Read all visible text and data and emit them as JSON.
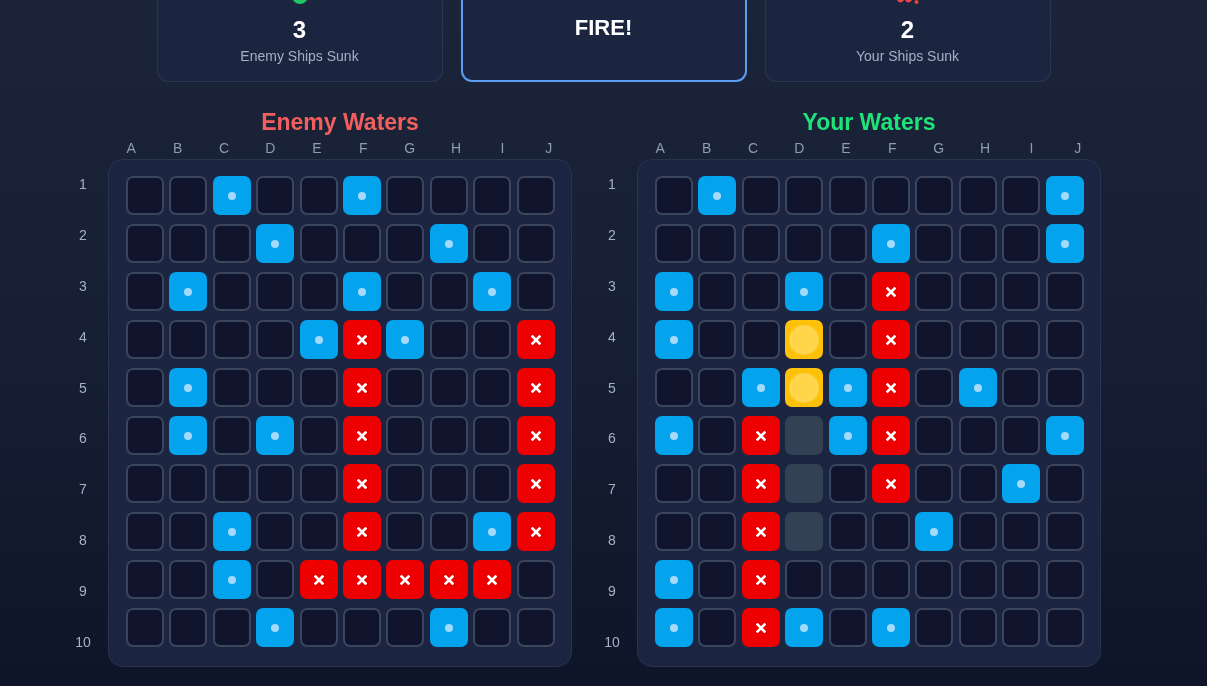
{
  "scoreboard": {
    "enemy_ships_sunk": {
      "value": "3",
      "label": "Enemy Ships Sunk"
    },
    "fire_button": {
      "label": "FIRE!"
    },
    "your_ships_sunk": {
      "value": "2",
      "label": "Your Ships Sunk"
    }
  },
  "boards": [
    {
      "title": "Enemy Waters",
      "color": "#f25f5c",
      "columns": [
        "A",
        "B",
        "C",
        "D",
        "E",
        "F",
        "G",
        "H",
        "I",
        "J"
      ],
      "rows": [
        {
          "label": "1",
          "cells": [
            {
              "kind": "empty"
            },
            {
              "kind": "empty"
            },
            {
              "kind": "miss"
            },
            {
              "kind": "empty"
            },
            {
              "kind": "empty"
            },
            {
              "kind": "miss"
            },
            {
              "kind": "empty"
            },
            {
              "kind": "empty"
            },
            {
              "kind": "empty"
            },
            {
              "kind": "empty"
            }
          ]
        },
        {
          "label": "2",
          "cells": [
            {
              "kind": "empty"
            },
            {
              "kind": "empty"
            },
            {
              "kind": "empty"
            },
            {
              "kind": "miss"
            },
            {
              "kind": "empty"
            },
            {
              "kind": "empty"
            },
            {
              "kind": "empty"
            },
            {
              "kind": "miss"
            },
            {
              "kind": "empty"
            },
            {
              "kind": "empty"
            }
          ]
        },
        {
          "label": "3",
          "cells": [
            {
              "kind": "empty"
            },
            {
              "kind": "miss"
            },
            {
              "kind": "empty"
            },
            {
              "kind": "empty"
            },
            {
              "kind": "empty"
            },
            {
              "kind": "miss"
            },
            {
              "kind": "empty"
            },
            {
              "kind": "empty"
            },
            {
              "kind": "miss"
            },
            {
              "kind": "empty"
            }
          ]
        },
        {
          "label": "4",
          "cells": [
            {
              "kind": "empty"
            },
            {
              "kind": "empty"
            },
            {
              "kind": "empty"
            },
            {
              "kind": "empty"
            },
            {
              "kind": "miss"
            },
            {
              "kind": "hit"
            },
            {
              "kind": "miss"
            },
            {
              "kind": "empty"
            },
            {
              "kind": "empty"
            },
            {
              "kind": "hit"
            }
          ]
        },
        {
          "label": "5",
          "cells": [
            {
              "kind": "empty"
            },
            {
              "kind": "miss"
            },
            {
              "kind": "empty"
            },
            {
              "kind": "empty"
            },
            {
              "kind": "empty"
            },
            {
              "kind": "hit"
            },
            {
              "kind": "empty"
            },
            {
              "kind": "empty"
            },
            {
              "kind": "empty"
            },
            {
              "kind": "hit"
            }
          ]
        },
        {
          "label": "6",
          "cells": [
            {
              "kind": "empty"
            },
            {
              "kind": "miss"
            },
            {
              "kind": "empty"
            },
            {
              "kind": "miss"
            },
            {
              "kind": "empty"
            },
            {
              "kind": "hit"
            },
            {
              "kind": "empty"
            },
            {
              "kind": "empty"
            },
            {
              "kind": "empty"
            },
            {
              "kind": "hit"
            }
          ]
        },
        {
          "label": "7",
          "cells": [
            {
              "kind": "empty"
            },
            {
              "kind": "empty"
            },
            {
              "kind": "empty"
            },
            {
              "kind": "empty"
            },
            {
              "kind": "empty"
            },
            {
              "kind": "hit"
            },
            {
              "kind": "empty"
            },
            {
              "kind": "empty"
            },
            {
              "kind": "empty"
            },
            {
              "kind": "hit"
            }
          ]
        },
        {
          "label": "8",
          "cells": [
            {
              "kind": "empty"
            },
            {
              "kind": "empty"
            },
            {
              "kind": "miss"
            },
            {
              "kind": "empty"
            },
            {
              "kind": "empty"
            },
            {
              "kind": "hit"
            },
            {
              "kind": "empty"
            },
            {
              "kind": "empty"
            },
            {
              "kind": "miss"
            },
            {
              "kind": "hit"
            }
          ]
        },
        {
          "label": "9",
          "cells": [
            {
              "kind": "empty"
            },
            {
              "kind": "empty"
            },
            {
              "kind": "miss"
            },
            {
              "kind": "empty"
            },
            {
              "kind": "hit"
            },
            {
              "kind": "hit"
            },
            {
              "kind": "hit"
            },
            {
              "kind": "hit"
            },
            {
              "kind": "hit"
            },
            {
              "kind": "empty"
            }
          ]
        },
        {
          "label": "10",
          "cells": [
            {
              "kind": "empty"
            },
            {
              "kind": "empty"
            },
            {
              "kind": "empty"
            },
            {
              "kind": "miss"
            },
            {
              "kind": "empty"
            },
            {
              "kind": "empty"
            },
            {
              "kind": "empty"
            },
            {
              "kind": "miss"
            },
            {
              "kind": "empty"
            },
            {
              "kind": "empty"
            }
          ]
        }
      ]
    },
    {
      "title": "Your Waters",
      "color": "#1fe27a",
      "columns": [
        "A",
        "B",
        "C",
        "D",
        "E",
        "F",
        "G",
        "H",
        "I",
        "J"
      ],
      "rows": [
        {
          "label": "1",
          "cells": [
            {
              "kind": "empty"
            },
            {
              "kind": "miss"
            },
            {
              "kind": "empty"
            },
            {
              "kind": "empty"
            },
            {
              "kind": "empty"
            },
            {
              "kind": "empty"
            },
            {
              "kind": "empty"
            },
            {
              "kind": "empty"
            },
            {
              "kind": "empty"
            },
            {
              "kind": "miss"
            }
          ]
        },
        {
          "label": "2",
          "cells": [
            {
              "kind": "empty"
            },
            {
              "kind": "empty"
            },
            {
              "kind": "empty"
            },
            {
              "kind": "empty"
            },
            {
              "kind": "empty"
            },
            {
              "kind": "miss"
            },
            {
              "kind": "empty"
            },
            {
              "kind": "empty"
            },
            {
              "kind": "empty"
            },
            {
              "kind": "miss"
            }
          ]
        },
        {
          "label": "3",
          "cells": [
            {
              "kind": "miss"
            },
            {
              "kind": "empty"
            },
            {
              "kind": "empty"
            },
            {
              "kind": "miss"
            },
            {
              "kind": "empty"
            },
            {
              "kind": "hit"
            },
            {
              "kind": "empty"
            },
            {
              "kind": "empty"
            },
            {
              "kind": "empty"
            },
            {
              "kind": "empty"
            }
          ]
        },
        {
          "label": "4",
          "cells": [
            {
              "kind": "miss"
            },
            {
              "kind": "empty"
            },
            {
              "kind": "empty"
            },
            {
              "kind": "marked"
            },
            {
              "kind": "empty"
            },
            {
              "kind": "hit"
            },
            {
              "kind": "empty"
            },
            {
              "kind": "empty"
            },
            {
              "kind": "empty"
            },
            {
              "kind": "empty"
            }
          ]
        },
        {
          "label": "5",
          "cells": [
            {
              "kind": "empty"
            },
            {
              "kind": "empty"
            },
            {
              "kind": "miss"
            },
            {
              "kind": "marked"
            },
            {
              "kind": "miss"
            },
            {
              "kind": "hit"
            },
            {
              "kind": "empty"
            },
            {
              "kind": "miss"
            },
            {
              "kind": "empty"
            },
            {
              "kind": "empty"
            }
          ]
        },
        {
          "label": "6",
          "cells": [
            {
              "kind": "miss"
            },
            {
              "kind": "empty"
            },
            {
              "kind": "hit"
            },
            {
              "kind": "ship"
            },
            {
              "kind": "miss"
            },
            {
              "kind": "hit"
            },
            {
              "kind": "empty"
            },
            {
              "kind": "empty"
            },
            {
              "kind": "empty"
            },
            {
              "kind": "miss"
            }
          ]
        },
        {
          "label": "7",
          "cells": [
            {
              "kind": "empty"
            },
            {
              "kind": "empty"
            },
            {
              "kind": "hit"
            },
            {
              "kind": "ship"
            },
            {
              "kind": "empty"
            },
            {
              "kind": "hit"
            },
            {
              "kind": "empty"
            },
            {
              "kind": "empty"
            },
            {
              "kind": "miss"
            },
            {
              "kind": "empty"
            }
          ]
        },
        {
          "label": "8",
          "cells": [
            {
              "kind": "empty"
            },
            {
              "kind": "empty"
            },
            {
              "kind": "hit"
            },
            {
              "kind": "ship"
            },
            {
              "kind": "empty"
            },
            {
              "kind": "empty"
            },
            {
              "kind": "miss"
            },
            {
              "kind": "empty"
            },
            {
              "kind": "empty"
            },
            {
              "kind": "empty"
            }
          ]
        },
        {
          "label": "9",
          "cells": [
            {
              "kind": "miss"
            },
            {
              "kind": "empty"
            },
            {
              "kind": "hit"
            },
            {
              "kind": "empty"
            },
            {
              "kind": "empty"
            },
            {
              "kind": "empty"
            },
            {
              "kind": "empty"
            },
            {
              "kind": "empty"
            },
            {
              "kind": "empty"
            },
            {
              "kind": "empty"
            }
          ]
        },
        {
          "label": "10",
          "cells": [
            {
              "kind": "miss"
            },
            {
              "kind": "empty"
            },
            {
              "kind": "hit"
            },
            {
              "kind": "miss"
            },
            {
              "kind": "empty"
            },
            {
              "kind": "miss"
            },
            {
              "kind": "empty"
            },
            {
              "kind": "empty"
            },
            {
              "kind": "empty"
            },
            {
              "kind": "empty"
            }
          ]
        }
      ]
    }
  ]
}
